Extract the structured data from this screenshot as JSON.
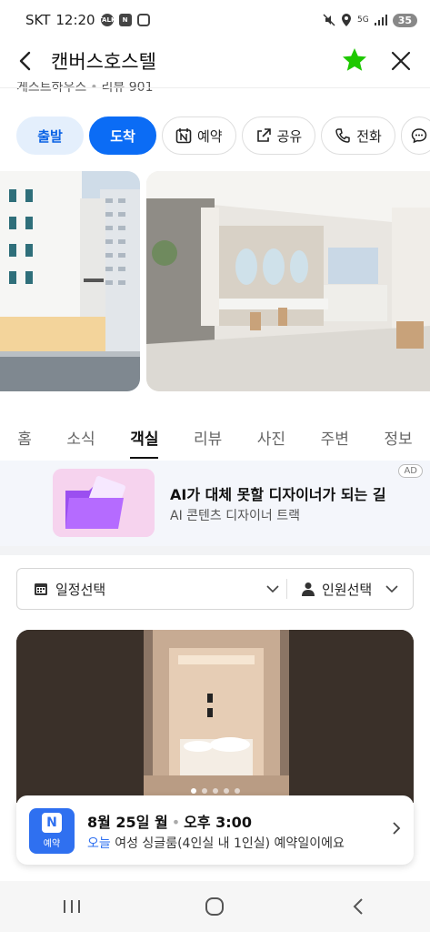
{
  "status_bar": {
    "carrier": "SKT",
    "time": "12:20",
    "battery": "35",
    "network": "5G"
  },
  "header": {
    "title": "캔버스호스텔",
    "category": "게스트하우스",
    "review_text": "리뷰 901",
    "star_color": "#1ec800"
  },
  "actions": [
    {
      "label": "출발",
      "icon": "none"
    },
    {
      "label": "도착",
      "icon": "none"
    },
    {
      "label": "예약",
      "icon": "naver-booking-icon"
    },
    {
      "label": "공유",
      "icon": "share-icon"
    },
    {
      "label": "전화",
      "icon": "phone-icon"
    }
  ],
  "tabs": [
    "홈",
    "소식",
    "객실",
    "리뷰",
    "사진",
    "주변",
    "정보"
  ],
  "active_tab": "객실",
  "ad": {
    "title": "AI가 대체 못할 디자이너가 되는 길",
    "subtitle": "AI 콘텐츠 디자이너 트랙",
    "badge": "AD"
  },
  "selector": {
    "date_label": "일정선택",
    "people_label": "인원선택"
  },
  "room_gallery": {
    "dot_count": 5,
    "active_dot": 1
  },
  "booking": {
    "badge_letter": "N",
    "badge_label": "예약",
    "date": "8월 25일 월",
    "time": "오후 3:00",
    "today": "오늘",
    "description": "여성 싱글룸(4인실 내 1인실) 예약일이에요"
  },
  "colors": {
    "primary": "#0b6cf5",
    "depart_bg": "#e4effc",
    "ad_bg": "#f4f6fb"
  }
}
